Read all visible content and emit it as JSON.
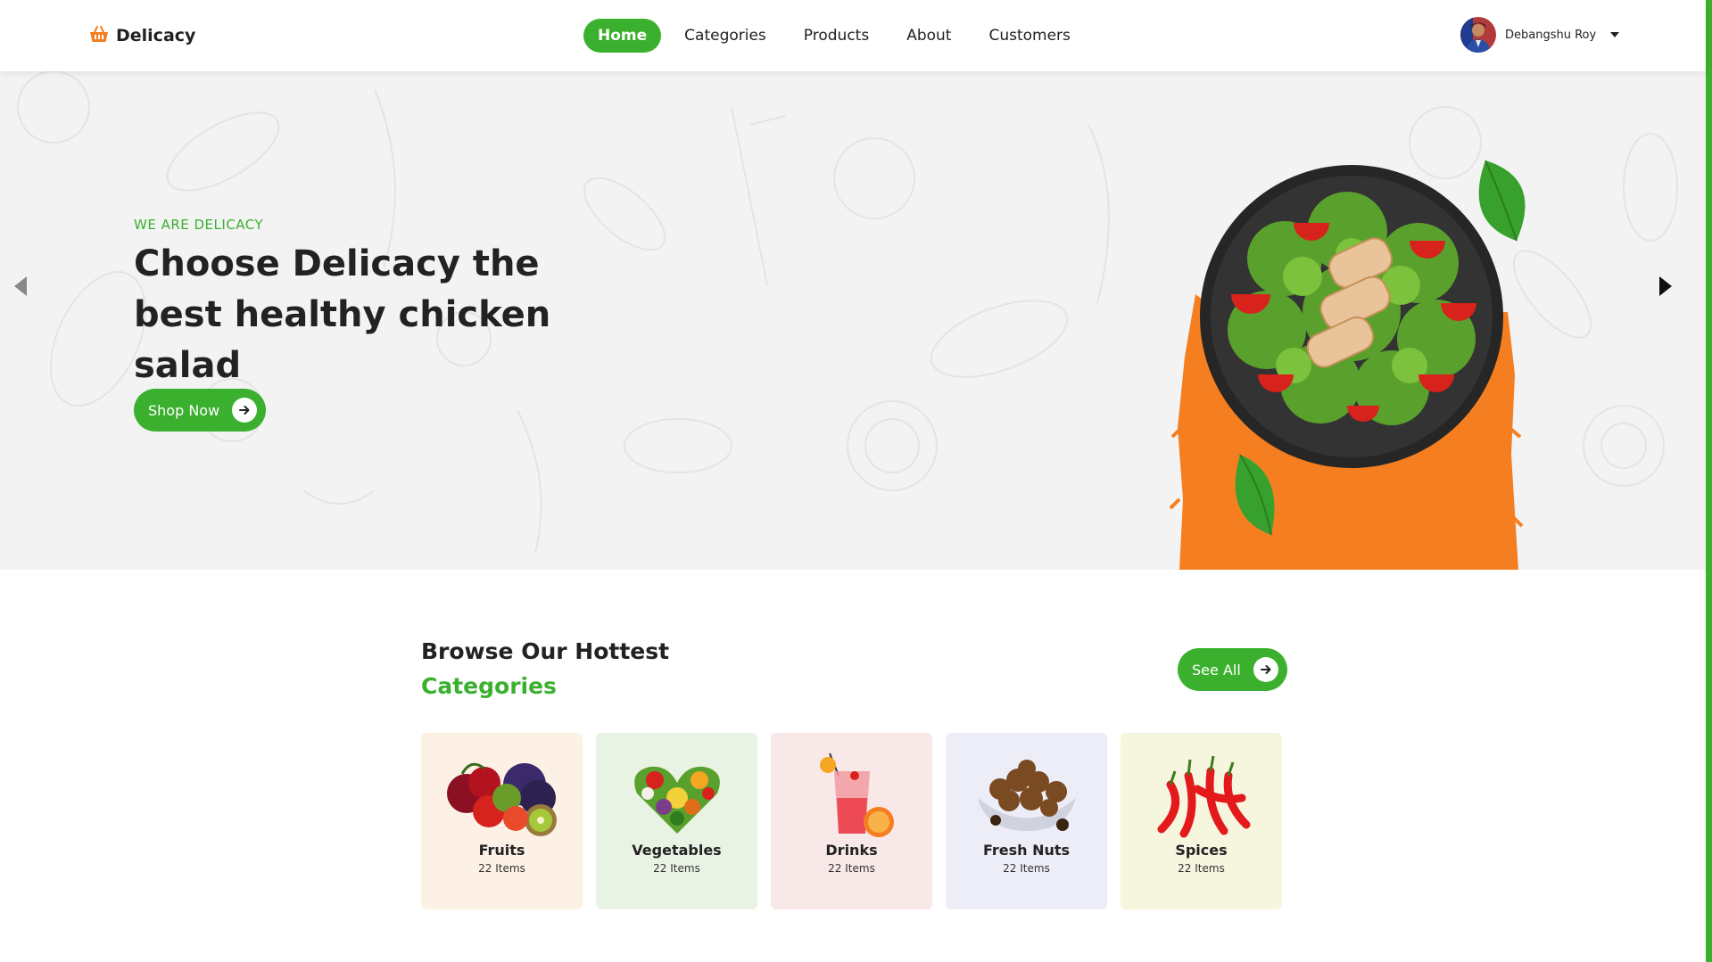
{
  "brand": {
    "name": "Delicacy",
    "icon": "basket-icon",
    "icon_color": "#f57f20"
  },
  "nav": {
    "items": [
      {
        "label": "Home",
        "active": true
      },
      {
        "label": "Categories",
        "active": false
      },
      {
        "label": "Products",
        "active": false
      },
      {
        "label": "About",
        "active": false
      },
      {
        "label": "Customers",
        "active": false
      }
    ]
  },
  "user": {
    "name": "Debangshu Roy",
    "menu_icon": "caret-down-icon"
  },
  "hero": {
    "eyebrow": "WE ARE DELICACY",
    "title": "Choose Delicacy the best healthy chicken salad",
    "cta_label": "Shop Now",
    "cta_icon": "arrow-right-icon",
    "prev_icon": "chevron-left-icon",
    "next_icon": "chevron-right-icon",
    "image": "chicken-salad-bowl"
  },
  "categories": {
    "title": "Browse Our Hottest",
    "subtitle": "Categories",
    "see_all_label": "See All",
    "items": [
      {
        "name": "Fruits",
        "count": "22 Items",
        "bg": "#fdf1e6",
        "image": "fruits-image"
      },
      {
        "name": "Vegetables",
        "count": "22 Items",
        "bg": "#e9f3e4",
        "image": "vegetables-image"
      },
      {
        "name": "Drinks",
        "count": "22 Items",
        "bg": "#f8e8e8",
        "image": "drinks-image"
      },
      {
        "name": "Fresh Nuts",
        "count": "22 Items",
        "bg": "#ecedf7",
        "image": "nuts-image"
      },
      {
        "name": "Spices",
        "count": "22 Items",
        "bg": "#f6f5de",
        "image": "spices-image"
      }
    ]
  },
  "colors": {
    "accent": "#3bb02e",
    "orange": "#f57f20",
    "hero_bg": "#f3f3f3"
  }
}
